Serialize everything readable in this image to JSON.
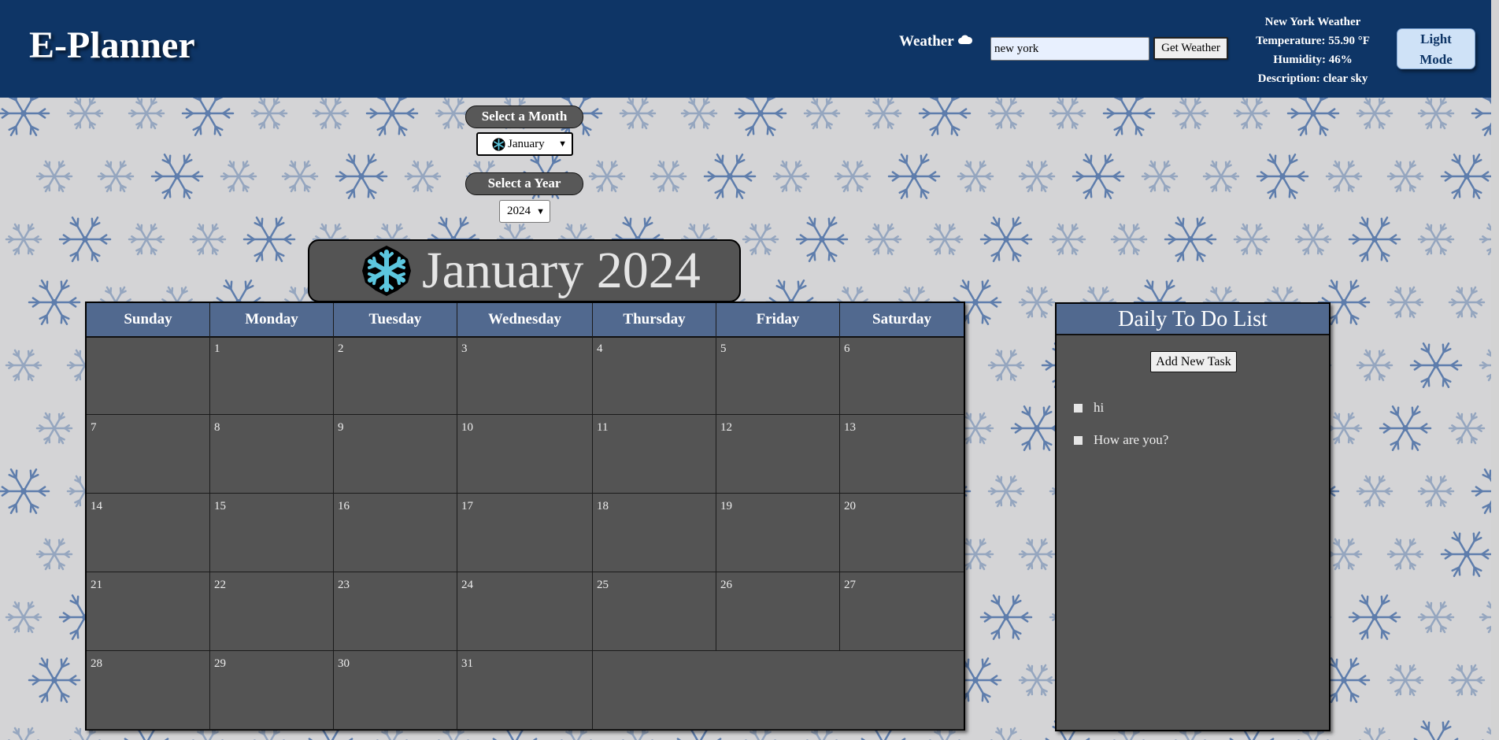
{
  "header": {
    "brand": "E-Planner",
    "weather_label": "Weather",
    "city_input_value": "new york",
    "get_weather_label": "Get Weather",
    "weather": {
      "title": "New York Weather",
      "temperature": "Temperature: 55.90 °F",
      "humidity": "Humidity: 46%",
      "description": "Description: clear sky"
    },
    "mode_button": "Light Mode"
  },
  "selectors": {
    "month_label": "Select a Month",
    "month_value": "January",
    "year_label": "Select a Year",
    "year_value": "2024"
  },
  "calendar": {
    "title": "January 2024",
    "weekdays": [
      "Sunday",
      "Monday",
      "Tuesday",
      "Wednesday",
      "Thursday",
      "Friday",
      "Saturday"
    ],
    "leading_blank_days": 1,
    "days_in_month": 31
  },
  "todo": {
    "title": "Daily To Do List",
    "add_button": "Add New Task",
    "tasks": [
      "hi",
      "How are you?"
    ]
  },
  "colors": {
    "header_bg": "#0e3566",
    "panel_header": "#51698f",
    "cell_bg": "#545454",
    "snowflake": "#4a6fa5"
  },
  "icons": {
    "weather": "cloud-icon",
    "month_select": "snowflake-icon",
    "title": "snowflake-icon"
  }
}
